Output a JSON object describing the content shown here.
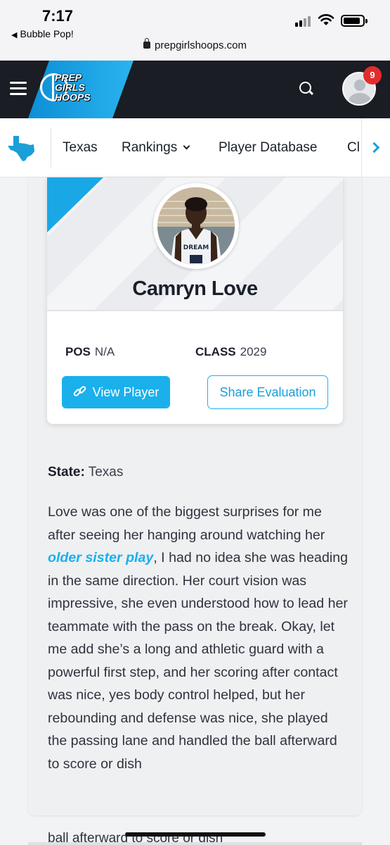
{
  "status_bar": {
    "time": "7:17",
    "back_app": "Bubble Pop!",
    "url": "prepgirlshoops.com"
  },
  "header": {
    "logo_lines": [
      "PREP",
      "GIRLS",
      "HOOPS"
    ],
    "notification_count": "9",
    "brand_color": "#1ab0ec"
  },
  "nav": {
    "items": [
      {
        "label": "Texas"
      },
      {
        "label": "Rankings"
      },
      {
        "label": "Player Database"
      },
      {
        "label": "Cl"
      }
    ]
  },
  "player": {
    "name": "Camryn Love",
    "pos_label": "POS",
    "pos_value": "N/A",
    "class_label": "CLASS",
    "class_value": "2029",
    "view_button": "View Player",
    "share_button": "Share Evaluation",
    "jersey_text": "DREAM"
  },
  "article": {
    "state_label": "State:",
    "state_value": "Texas",
    "text_before_link": "Love was one of the biggest surprises for me after seeing her hanging around watching her ",
    "link_text": "older sister play",
    "text_after_link": ", I had no idea she was heading in the same direction. Her court vision was impressive, she even understood how to lead her teammate with the pass on the break. Okay, let me add she’s a long and athletic guard with a powerful first step, and her scoring after contact was nice, yes body control helped, but her rebounding and defense was nice, she played the passing lane and handled the ball afterward to score or dish",
    "overflow_text": "ball afterward to score or dish"
  }
}
